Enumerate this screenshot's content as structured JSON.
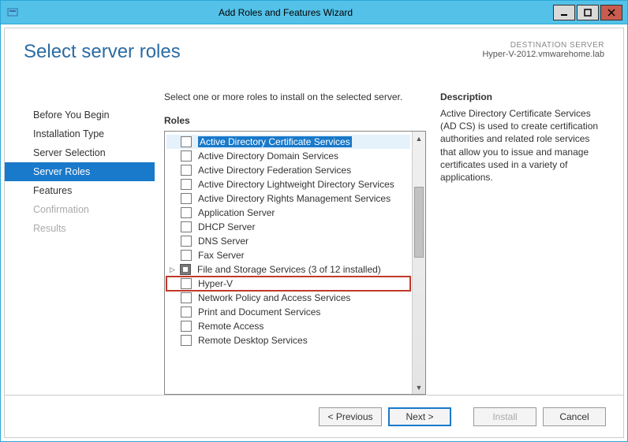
{
  "window": {
    "title": "Add Roles and Features Wizard"
  },
  "header": {
    "page_title": "Select server roles",
    "dest_label": "DESTINATION SERVER",
    "dest_value": "Hyper-V-2012.vmwarehome.lab"
  },
  "nav": {
    "items": [
      {
        "label": "Before You Begin",
        "state": "normal"
      },
      {
        "label": "Installation Type",
        "state": "normal"
      },
      {
        "label": "Server Selection",
        "state": "normal"
      },
      {
        "label": "Server Roles",
        "state": "active"
      },
      {
        "label": "Features",
        "state": "normal"
      },
      {
        "label": "Confirmation",
        "state": "disabled"
      },
      {
        "label": "Results",
        "state": "disabled"
      }
    ]
  },
  "main": {
    "instruction": "Select one or more roles to install on the selected server.",
    "roles_label": "Roles",
    "roles": [
      {
        "label": "Active Directory Certificate Services",
        "checked": false,
        "selected": true
      },
      {
        "label": "Active Directory Domain Services",
        "checked": false
      },
      {
        "label": "Active Directory Federation Services",
        "checked": false
      },
      {
        "label": "Active Directory Lightweight Directory Services",
        "checked": false
      },
      {
        "label": "Active Directory Rights Management Services",
        "checked": false
      },
      {
        "label": "Application Server",
        "checked": false
      },
      {
        "label": "DHCP Server",
        "checked": false
      },
      {
        "label": "DNS Server",
        "checked": false
      },
      {
        "label": "Fax Server",
        "checked": false
      },
      {
        "label": "File and Storage Services (3 of 12 installed)",
        "checked": "indeterminate",
        "expandable": true
      },
      {
        "label": "Hyper-V",
        "checked": false,
        "highlighted": true
      },
      {
        "label": "Network Policy and Access Services",
        "checked": false
      },
      {
        "label": "Print and Document Services",
        "checked": false
      },
      {
        "label": "Remote Access",
        "checked": false
      },
      {
        "label": "Remote Desktop Services",
        "checked": false
      }
    ]
  },
  "description": {
    "label": "Description",
    "text": "Active Directory Certificate Services (AD CS) is used to create certification authorities and related role services that allow you to issue and manage certificates used in a variety of applications."
  },
  "footer": {
    "previous": "< Previous",
    "next": "Next >",
    "install": "Install",
    "cancel": "Cancel"
  }
}
